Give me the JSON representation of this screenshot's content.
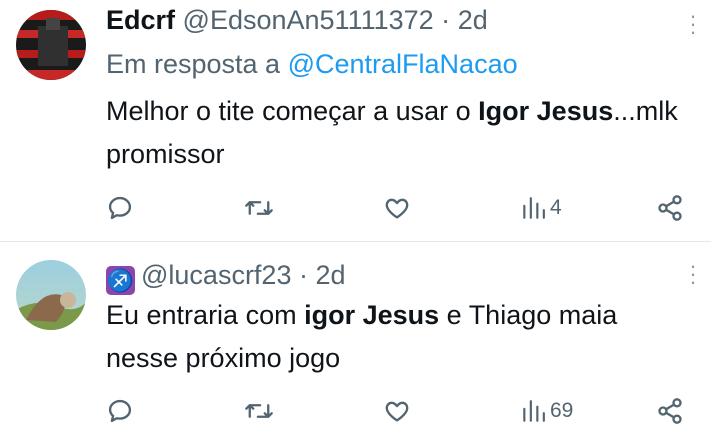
{
  "tweets": [
    {
      "name": "Edcrf",
      "handle": "@EdsonAn51111372",
      "separator": "·",
      "time": "2d",
      "reply_prefix": "Em resposta a",
      "reply_to": "@CentralFlaNacao",
      "text_parts": [
        "Melhor o tite começar a usar o ",
        "Igor Jesus",
        "...mlk promissor"
      ],
      "metrics": {
        "replies": "",
        "retweets": "",
        "likes": "",
        "views": "4"
      }
    },
    {
      "emoji": "♐",
      "handle": "@lucascrf23",
      "separator": "·",
      "time": "2d",
      "text_parts": [
        "Eu entraria com ",
        "igor Jesus",
        " e Thiago maia nesse próximo jogo"
      ],
      "metrics": {
        "replies": "",
        "retweets": "",
        "likes": "",
        "views": "69"
      }
    }
  ],
  "icons": {
    "reply": "reply-icon",
    "retweet": "retweet-icon",
    "like": "heart-icon",
    "views": "views-icon",
    "share": "share-icon",
    "more": "more-options-icon"
  },
  "colors": {
    "text": "#0f1419",
    "muted": "#536471",
    "link": "#1d9bf0",
    "divider": "#e6e9eb"
  }
}
